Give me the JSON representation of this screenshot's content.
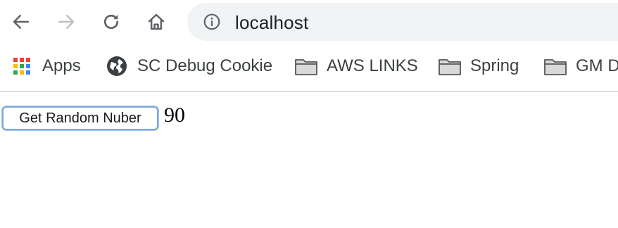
{
  "browser": {
    "address_bar": {
      "url": "localhost"
    },
    "nav_icons": [
      "back-arrow-icon",
      "forward-arrow-icon",
      "reload-icon",
      "home-icon"
    ]
  },
  "bookmarks": [
    {
      "label": "Apps",
      "icon": "apps-grid-icon"
    },
    {
      "label": "SC Debug Cookie",
      "icon": "globe-icon"
    },
    {
      "label": "AWS LINKS",
      "icon": "folder-icon"
    },
    {
      "label": "Spring",
      "icon": "folder-icon"
    },
    {
      "label": "GM D",
      "icon": "folder-icon"
    }
  ],
  "page": {
    "button_label": "Get Random Nuber",
    "random_value": "90"
  },
  "colors": {
    "omnibox_bg": "#f1f3f4",
    "button_focus_ring": "#7aa7e0",
    "apps_red": "#ea4335",
    "apps_yellow": "#fbbc04",
    "apps_green": "#34a853",
    "apps_blue": "#4285f4"
  }
}
